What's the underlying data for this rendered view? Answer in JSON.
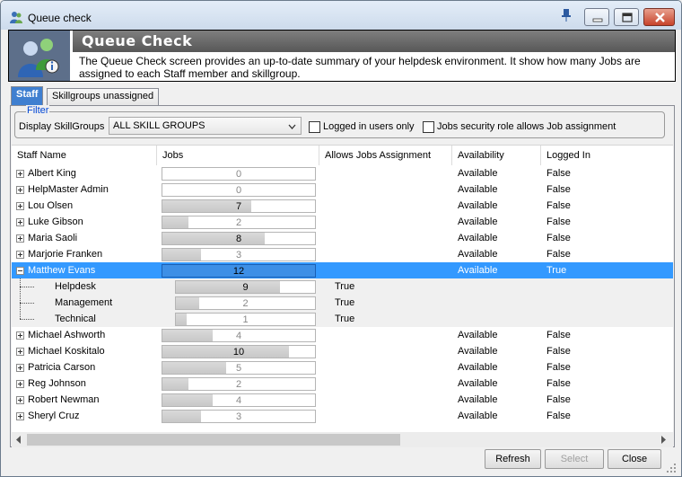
{
  "window": {
    "title": "Queue check"
  },
  "banner": {
    "title": "Queue Check",
    "description": "The Queue Check screen provides an up-to-date summary of your helpdesk environment.  It show how many Jobs are assigned to each Staff member and skillgroup."
  },
  "tabs": [
    {
      "label": "Staff",
      "active": true
    },
    {
      "label": "Skillgroups unassigned",
      "active": false
    }
  ],
  "filter": {
    "legend": "Filter",
    "display_label": "Display SkillGroups",
    "skillgroup_selected": "ALL SKILL GROUPS",
    "logged_in_only_label": "Logged in users only",
    "logged_in_only_checked": false,
    "security_role_label": "Jobs security role allows Job assignment",
    "security_role_checked": false
  },
  "grid": {
    "columns": [
      "Staff Name",
      "Jobs",
      "Allows Jobs Assignment",
      "Availability",
      "Logged In"
    ],
    "rows": [
      {
        "name": "Albert King",
        "jobs": "0",
        "fill": 0,
        "availability": "Available",
        "logged_in": "False"
      },
      {
        "name": "HelpMaster Admin",
        "jobs": "0",
        "fill": 0,
        "availability": "Available",
        "logged_in": "False"
      },
      {
        "name": "Lou Olsen",
        "jobs": "7",
        "fill": 0.58,
        "availability": "Available",
        "logged_in": "False"
      },
      {
        "name": "Luke Gibson",
        "jobs": "2",
        "fill": 0.17,
        "availability": "Available",
        "logged_in": "False"
      },
      {
        "name": "Maria Saoli",
        "jobs": "8",
        "fill": 0.67,
        "availability": "Available",
        "logged_in": "False"
      },
      {
        "name": "Marjorie Franken",
        "jobs": "3",
        "fill": 0.25,
        "availability": "Available",
        "logged_in": "False"
      },
      {
        "name": "Matthew Evans",
        "jobs": "12",
        "fill": 1.0,
        "availability": "Available",
        "logged_in": "True",
        "selected": true,
        "expanded": true,
        "children": [
          {
            "name": "Helpdesk",
            "jobs": "9",
            "fill": 0.75,
            "allows": "True"
          },
          {
            "name": "Management",
            "jobs": "2",
            "fill": 0.17,
            "allows": "True"
          },
          {
            "name": "Technical",
            "jobs": "1",
            "fill": 0.08,
            "allows": "True"
          }
        ]
      },
      {
        "name": "Michael Ashworth",
        "jobs": "4",
        "fill": 0.33,
        "availability": "Available",
        "logged_in": "False"
      },
      {
        "name": "Michael Koskitalo",
        "jobs": "10",
        "fill": 0.83,
        "availability": "Available",
        "logged_in": "False"
      },
      {
        "name": "Patricia Carson",
        "jobs": "5",
        "fill": 0.42,
        "availability": "Available",
        "logged_in": "False"
      },
      {
        "name": "Reg Johnson",
        "jobs": "2",
        "fill": 0.17,
        "availability": "Available",
        "logged_in": "False"
      },
      {
        "name": "Robert Newman",
        "jobs": "4",
        "fill": 0.33,
        "availability": "Available",
        "logged_in": "False"
      },
      {
        "name": "Sheryl Cruz",
        "jobs": "3",
        "fill": 0.25,
        "availability": "Available",
        "logged_in": "False"
      }
    ]
  },
  "buttons": {
    "refresh": "Refresh",
    "select": "Select",
    "close": "Close"
  },
  "colors": {
    "selection": "#3399ff",
    "banner_icon_bg": "#5d6f8a"
  }
}
